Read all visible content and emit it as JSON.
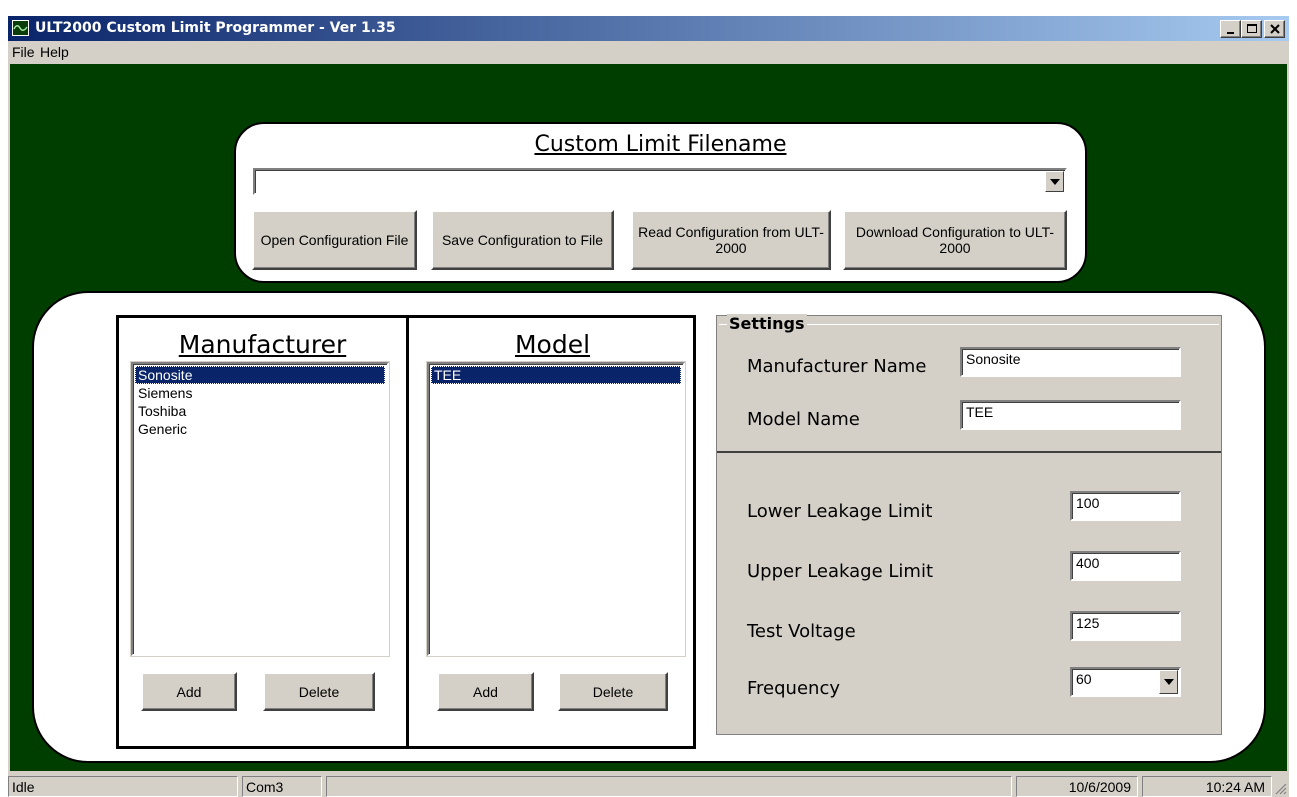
{
  "window": {
    "title": "ULT2000 Custom Limit Programmer - Ver 1.35"
  },
  "menu": {
    "file": "File",
    "help": "Help"
  },
  "file_panel": {
    "heading": "Custom Limit Filename",
    "filename_value": "",
    "open_button": "Open Configuration File",
    "save_button": "Save Configuration to File",
    "read_button": "Read Configuration from ULT-2000",
    "download_button": "Download Configuration to ULT-2000"
  },
  "manufacturer": {
    "heading": "Manufacturer",
    "items": [
      "Sonosite",
      "Siemens",
      "Toshiba",
      "Generic"
    ],
    "selected": "Sonosite",
    "add_button": "Add",
    "delete_button": "Delete"
  },
  "model": {
    "heading": "Model",
    "items": [
      "TEE"
    ],
    "selected": "TEE",
    "add_button": "Add",
    "delete_button": "Delete"
  },
  "settings": {
    "legend": "Settings",
    "manufacturer_name_label": "Manufacturer Name",
    "manufacturer_name_value": "Sonosite",
    "model_name_label": "Model Name",
    "model_name_value": "TEE",
    "lower_leakage_label": "Lower Leakage Limit",
    "lower_leakage_value": "100",
    "upper_leakage_label": "Upper Leakage Limit",
    "upper_leakage_value": "400",
    "test_voltage_label": "Test Voltage",
    "test_voltage_value": "125",
    "frequency_label": "Frequency",
    "frequency_value": "60"
  },
  "statusbar": {
    "status": "Idle",
    "port": "Com3",
    "message": "",
    "date": "10/6/2009",
    "time": "10:24 AM"
  },
  "colors": {
    "client_background": "#003e00",
    "titlebar_start": "#0a246a",
    "titlebar_end": "#a6caf0",
    "selection": "#0a246a",
    "face": "#d4d0c8"
  }
}
